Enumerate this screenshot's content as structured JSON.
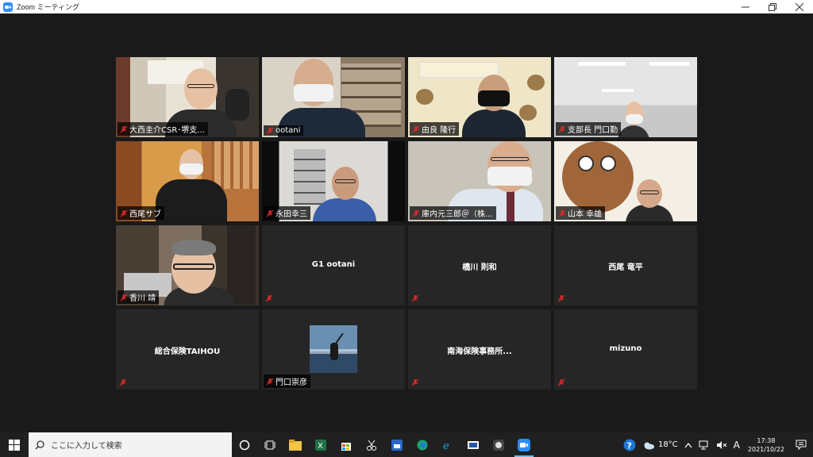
{
  "window": {
    "title": "Zoom ミーティング"
  },
  "tiles": [
    {
      "name": "大西圭介CSR･堺支..."
    },
    {
      "name": "ootani"
    },
    {
      "name": "由良 隆行"
    },
    {
      "name": "支部長  門口勤"
    },
    {
      "name": "西尾サブ"
    },
    {
      "name": "永田幸三"
    },
    {
      "name": "庫内元三郎＠（株..."
    },
    {
      "name": "山本 幸雄"
    },
    {
      "name": "香川 靖"
    },
    {
      "name": "G1 ootani"
    },
    {
      "name": "橋川 則和"
    },
    {
      "name": "西尾 竜平"
    },
    {
      "name": "総合保険TAIHOU"
    },
    {
      "name": "門口崇彦"
    },
    {
      "name": "南海保険事務所..."
    },
    {
      "name": "mizuno"
    }
  ],
  "taskbar": {
    "search_placeholder": "ここに入力して検索",
    "temperature": "18°C",
    "ime": "A",
    "time": "17:38",
    "date": "2021/10/22"
  },
  "colors": {
    "active_speaker": "#b8e23e",
    "mute": "#e02828",
    "zoom_blue": "#2d8cff"
  }
}
